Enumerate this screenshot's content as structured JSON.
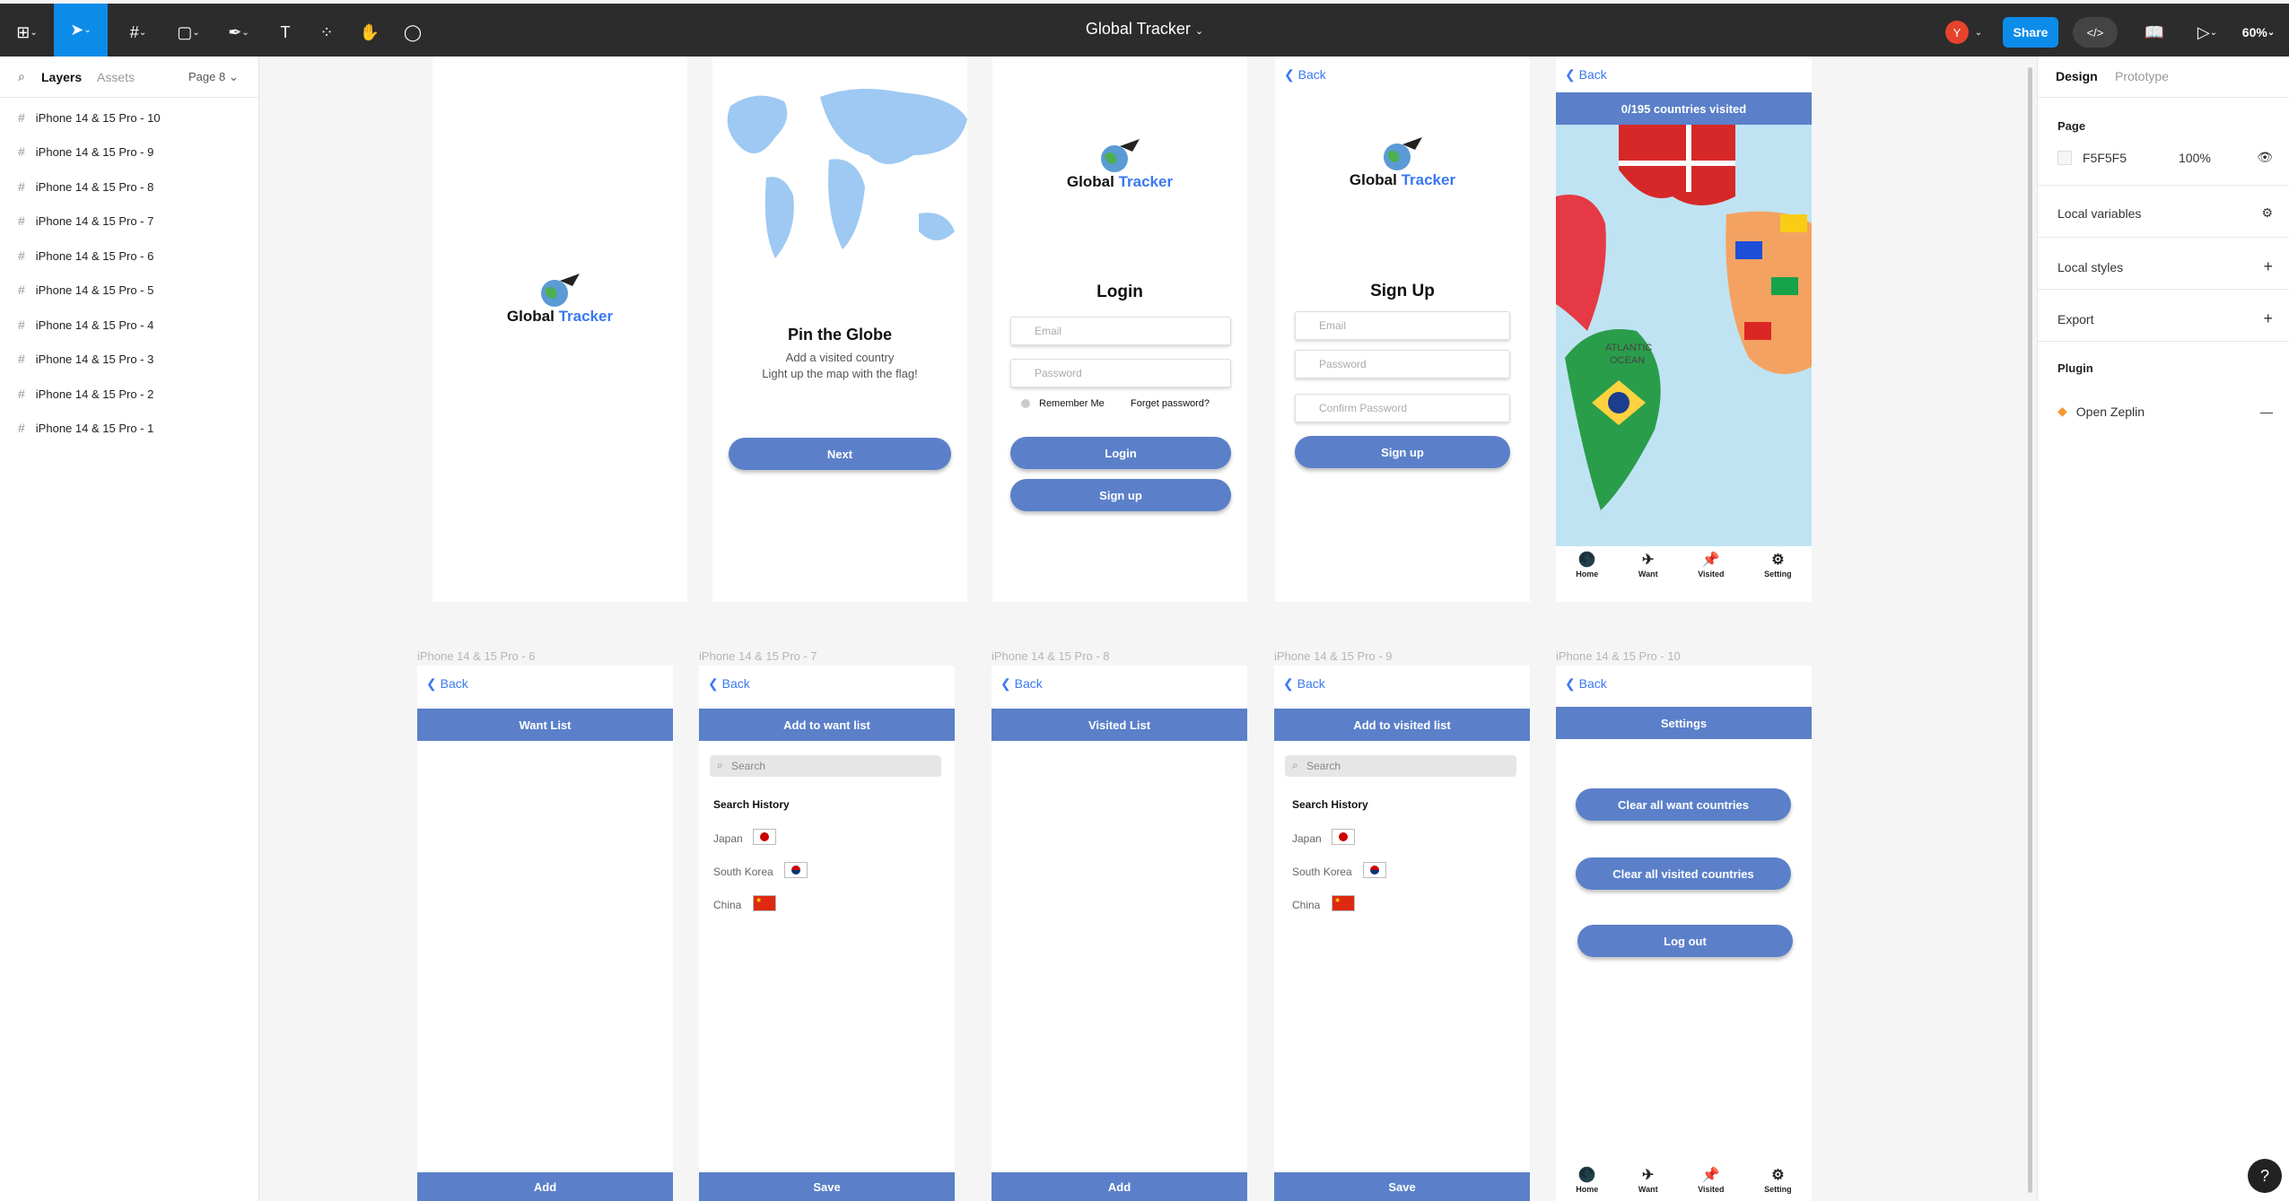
{
  "app": {
    "title": "Global Tracker",
    "zoom": "60%",
    "share_label": "Share",
    "avatar_initial": "Y"
  },
  "left_panel": {
    "tabs": [
      "Layers",
      "Assets"
    ],
    "page_selector": "Page 8",
    "layers": [
      "iPhone 14 & 15 Pro - 10",
      "iPhone 14 & 15 Pro - 9",
      "iPhone 14 & 15 Pro - 8",
      "iPhone 14 & 15 Pro - 7",
      "iPhone 14 & 15 Pro - 6",
      "iPhone 14 & 15 Pro - 5",
      "iPhone 14 & 15 Pro - 4",
      "iPhone 14 & 15 Pro - 3",
      "iPhone 14 & 15 Pro - 2",
      "iPhone 14 & 15 Pro - 1"
    ]
  },
  "right_panel": {
    "tabs": [
      "Design",
      "Prototype"
    ],
    "page_heading": "Page",
    "page_color": "F5F5F5",
    "page_opacity": "100%",
    "local_variables": "Local variables",
    "local_styles": "Local styles",
    "export": "Export",
    "plugin": "Plugin",
    "plugin_item": "Open Zeplin"
  },
  "frames": {
    "logo_word1": "Global",
    "logo_word2": "Tracker",
    "back": "Back",
    "f2": {
      "title": "Pin the Globe",
      "sub1": "Add a visited country",
      "sub2": "Light up the map with the flag!",
      "next": "Next"
    },
    "f3": {
      "title": "Login",
      "email": "Email",
      "password": "Password",
      "remember": "Remember Me",
      "forget": "Forget password?",
      "login": "Login",
      "signup": "Sign up"
    },
    "f4": {
      "title": "Sign Up",
      "email": "Email",
      "password": "Password",
      "confirm": "Confirm Password",
      "signup": "Sign up"
    },
    "f5": {
      "banner": "0/195 countries visited",
      "map_label1": "ATLANTIC",
      "map_label2": "OCEAN"
    },
    "nav": [
      "Home",
      "Want",
      "Visited",
      "Setting"
    ],
    "labels_row2": [
      "iPhone 14 & 15 Pro - 6",
      "iPhone 14 & 15 Pro - 7",
      "iPhone 14 & 15 Pro - 8",
      "iPhone 14 & 15 Pro - 9",
      "iPhone 14 & 15 Pro - 10"
    ],
    "f6": {
      "header": "Want List",
      "bottom": "Add"
    },
    "f7": {
      "header": "Add to want list",
      "search": "Search",
      "history": "Search History",
      "countries": [
        "Japan",
        "South Korea",
        "China"
      ],
      "bottom": "Save"
    },
    "f8": {
      "header": "Visited List",
      "bottom": "Add"
    },
    "f9": {
      "header": "Add to visited list",
      "search": "Search",
      "history": "Search History",
      "countries": [
        "Japan",
        "South Korea",
        "China"
      ],
      "bottom": "Save"
    },
    "f10": {
      "header": "Settings",
      "btn1": "Clear all want countries",
      "btn2": "Clear all visited countries",
      "btn3": "Log out"
    }
  }
}
